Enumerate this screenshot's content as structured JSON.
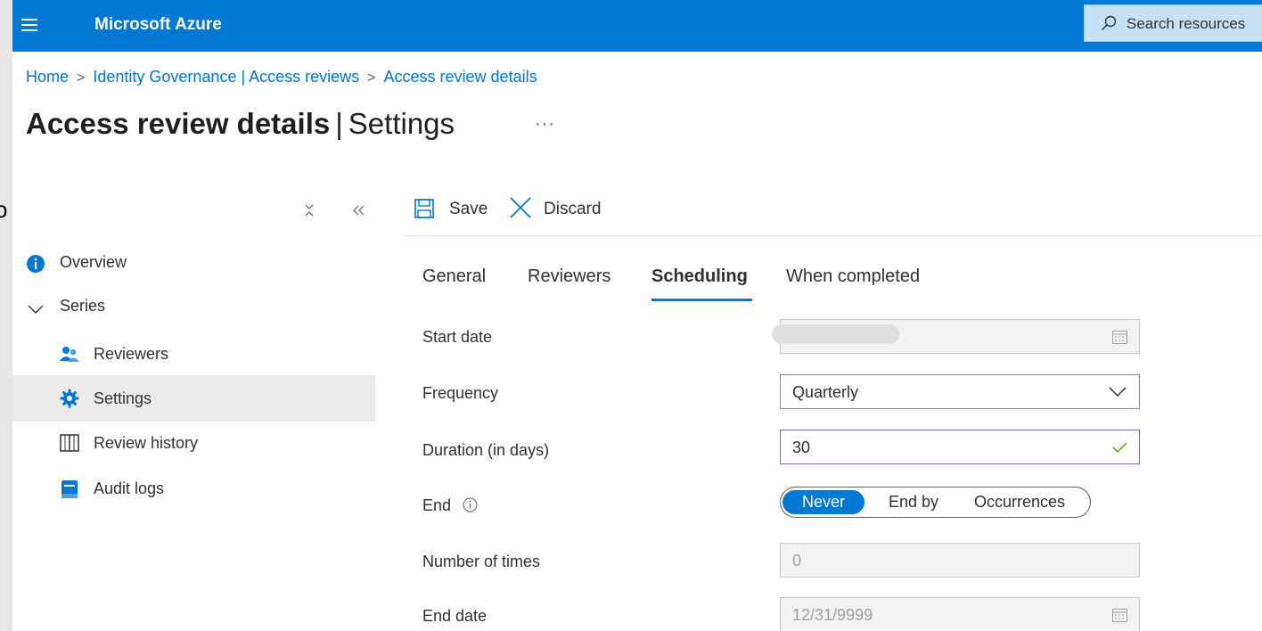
{
  "topbar": {
    "brand": "Microsoft Azure",
    "search_placeholder": "Search resources",
    "accent": "#0078d4"
  },
  "left_fragment": "o",
  "breadcrumb": {
    "items": [
      "Home",
      "Identity Governance | Access reviews",
      "Access review details"
    ]
  },
  "page": {
    "title_bold": "Access review details",
    "title_sep": "|",
    "title_rest": "Settings",
    "more": "···"
  },
  "sidenav": {
    "items": [
      {
        "label": "Overview",
        "icon": "info-icon"
      },
      {
        "label": "Series",
        "icon": "chevron-down-icon"
      },
      {
        "label": "Reviewers",
        "icon": "people-icon"
      },
      {
        "label": "Settings",
        "icon": "gear-icon",
        "active": true
      },
      {
        "label": "Review history",
        "icon": "book-icon"
      },
      {
        "label": "Audit logs",
        "icon": "log-icon"
      }
    ]
  },
  "toolbar": {
    "save_label": "Save",
    "discard_label": "Discard"
  },
  "tabs": [
    {
      "label": "General"
    },
    {
      "label": "Reviewers"
    },
    {
      "label": "Scheduling",
      "active": true
    },
    {
      "label": "When completed"
    }
  ],
  "form": {
    "start_date": {
      "label": "Start date",
      "value": ""
    },
    "frequency": {
      "label": "Frequency",
      "value": "Quarterly"
    },
    "duration": {
      "label": "Duration (in days)",
      "value": "30"
    },
    "end": {
      "label": "End",
      "options": [
        "Never",
        "End by",
        "Occurrences"
      ],
      "selected": "Never"
    },
    "number_of_times": {
      "label": "Number of times",
      "value": "0"
    },
    "end_date": {
      "label": "End date",
      "value": "12/31/9999"
    }
  }
}
